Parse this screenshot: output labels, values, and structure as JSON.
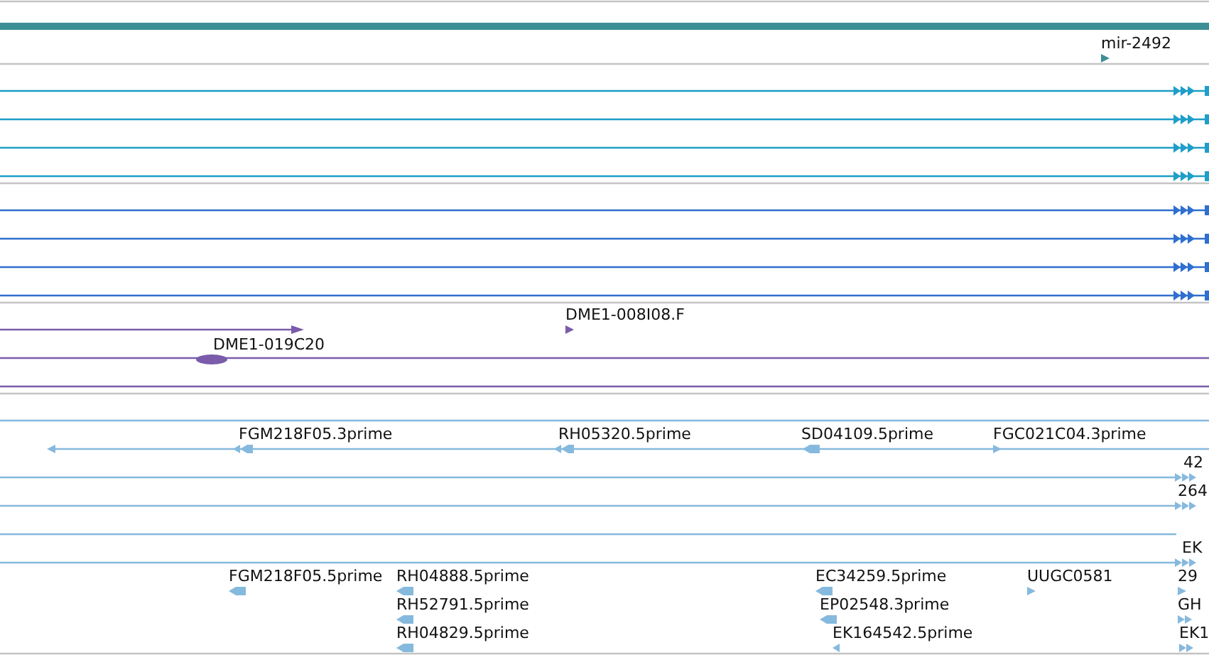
{
  "tracks": [
    {
      "kind": "mirna",
      "features": [
        {
          "label": "mir-2492"
        }
      ]
    },
    {
      "kind": "transcripts"
    },
    {
      "kind": "cdna",
      "features": [
        {
          "label": "DME1-008I08.F"
        },
        {
          "label": "DME1-019C20"
        }
      ]
    },
    {
      "kind": "est",
      "features": [
        {
          "label": "FGM218F05.3prime"
        },
        {
          "label": "RH05320.5prime"
        },
        {
          "label": "SD04109.5prime"
        },
        {
          "label": "FGC021C04.3prime"
        },
        {
          "label": "42"
        },
        {
          "label": "264"
        },
        {
          "label": "EK"
        },
        {
          "label": "FGM218F05.5prime"
        },
        {
          "label": "RH04888.5prime"
        },
        {
          "label": "EC34259.5prime"
        },
        {
          "label": "UUGC0581"
        },
        {
          "label": "29"
        },
        {
          "label": "RH52791.5prime"
        },
        {
          "label": "EP02548.3prime"
        },
        {
          "label": "GH"
        },
        {
          "label": "RH04829.5prime"
        },
        {
          "label": "EK164542.5prime"
        },
        {
          "label": "EK1"
        }
      ]
    }
  ]
}
